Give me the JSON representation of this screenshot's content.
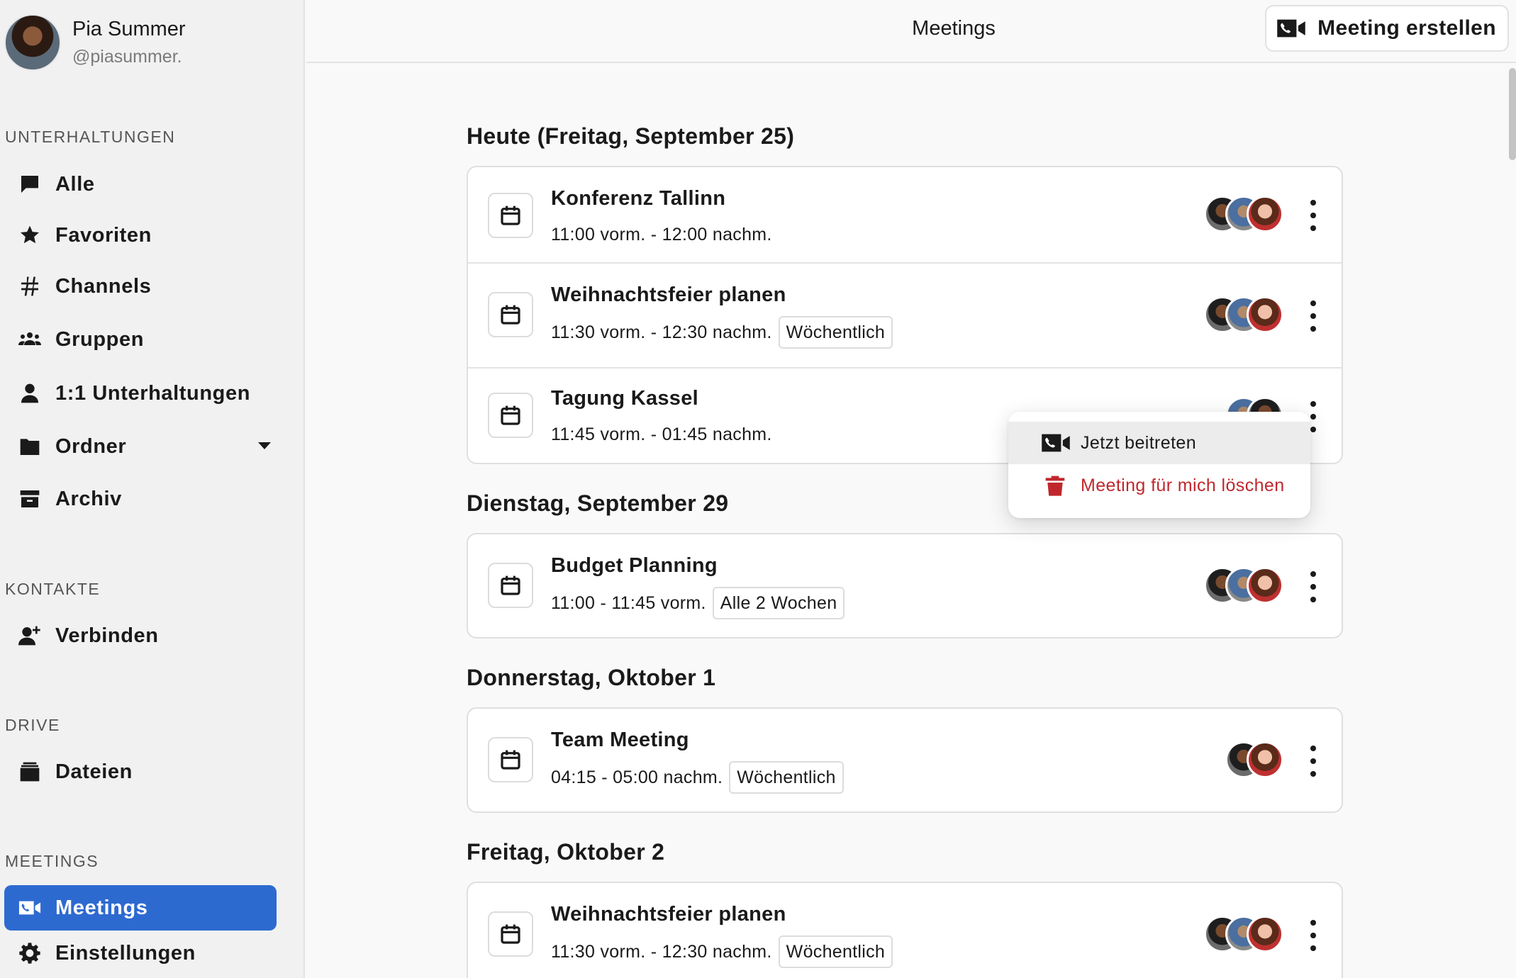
{
  "user": {
    "name": "Pia Summer",
    "handle": "@piasummer."
  },
  "sidebar": {
    "sections": {
      "conversations": "UNTERHALTUNGEN",
      "contacts": "KONTAKTE",
      "drive": "DRIVE",
      "meetings": "MEETINGS"
    },
    "items": {
      "all": "Alle",
      "favorites": "Favoriten",
      "channels": "Channels",
      "groups": "Gruppen",
      "direct": "1:1 Unterhaltungen",
      "folders": "Ordner",
      "archive": "Archiv",
      "connect": "Verbinden",
      "files": "Dateien",
      "meetings": "Meetings",
      "settings": "Einstellungen"
    },
    "active_item": "meetings"
  },
  "header": {
    "title": "Meetings",
    "create_button": "Meeting erstellen"
  },
  "days": [
    {
      "heading": "Heute (Freitag, September 25)",
      "meetings": [
        {
          "title": "Konferenz Tallinn",
          "time": "11:00 vorm. - 12:00 nachm.",
          "recurrence": "",
          "participants": 3
        },
        {
          "title": "Weihnachtsfeier planen",
          "time": "11:30 vorm. - 12:30 nachm.",
          "recurrence": "Wöchentlich",
          "participants": 3
        },
        {
          "title": "Tagung Kassel",
          "time": "11:45 vorm. - 01:45 nachm.",
          "recurrence": "",
          "participants": 2
        }
      ]
    },
    {
      "heading": "Dienstag, September 29",
      "meetings": [
        {
          "title": "Budget Planning",
          "time": "11:00 - 11:45 vorm.",
          "recurrence": "Alle 2 Wochen",
          "participants": 3
        }
      ]
    },
    {
      "heading": "Donnerstag, Oktober 1",
      "meetings": [
        {
          "title": "Team Meeting",
          "time": "04:15 - 05:00 nachm.",
          "recurrence": "Wöchentlich",
          "participants": 2
        }
      ]
    },
    {
      "heading": "Freitag, Oktober 2",
      "meetings": [
        {
          "title": "Weihnachtsfeier planen",
          "time": "11:30 vorm. - 12:30 nachm.",
          "recurrence": "Wöchentlich",
          "participants": 3
        }
      ]
    }
  ],
  "context_menu": {
    "join": "Jetzt beitreten",
    "delete": "Meeting für mich löschen"
  },
  "colors": {
    "accent": "#2d6ad0",
    "danger": "#c0272d",
    "sidebar_bg": "#f1f1f1",
    "page_bg": "#f9f9f9"
  },
  "icons": {
    "all": "chat-bubble-icon",
    "favorites": "star-icon",
    "channels": "hashtag-icon",
    "groups": "group-icon",
    "direct": "person-icon",
    "folders": "folder-icon",
    "archive": "archive-box-icon",
    "connect": "add-person-icon",
    "files": "file-cabinet-icon",
    "meetings": "video-phone-icon",
    "settings": "gear-icon",
    "meeting_row": "calendar-icon",
    "delete": "trash-icon"
  }
}
